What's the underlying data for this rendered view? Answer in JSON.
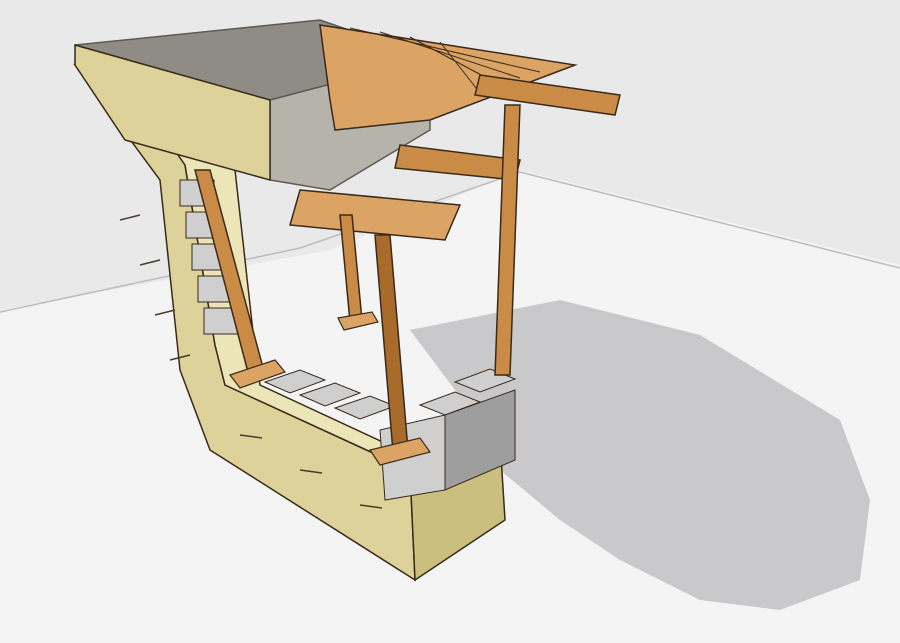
{
  "scene": {
    "colors": {
      "background_wall": "#e9e9ea",
      "floor": "#f4f4f5",
      "floor_line": "#bdbdbf",
      "shadow": "#c9c9cb",
      "insulation_light": "#ece5b8",
      "insulation_mid": "#ddd39a",
      "insulation_dark": "#cbbf80",
      "concrete_top": "#8e8c84",
      "concrete_side": "#b6b3ab",
      "concrete_edge": "#5c5a55",
      "block_face": "#cfcfcf",
      "block_dark": "#9e9e9e",
      "wood_light": "#dca464",
      "wood_mid": "#c98b45",
      "wood_dark": "#a86b2c",
      "outline": "#3a2a1a",
      "rebar": "#4a3a2a"
    }
  }
}
